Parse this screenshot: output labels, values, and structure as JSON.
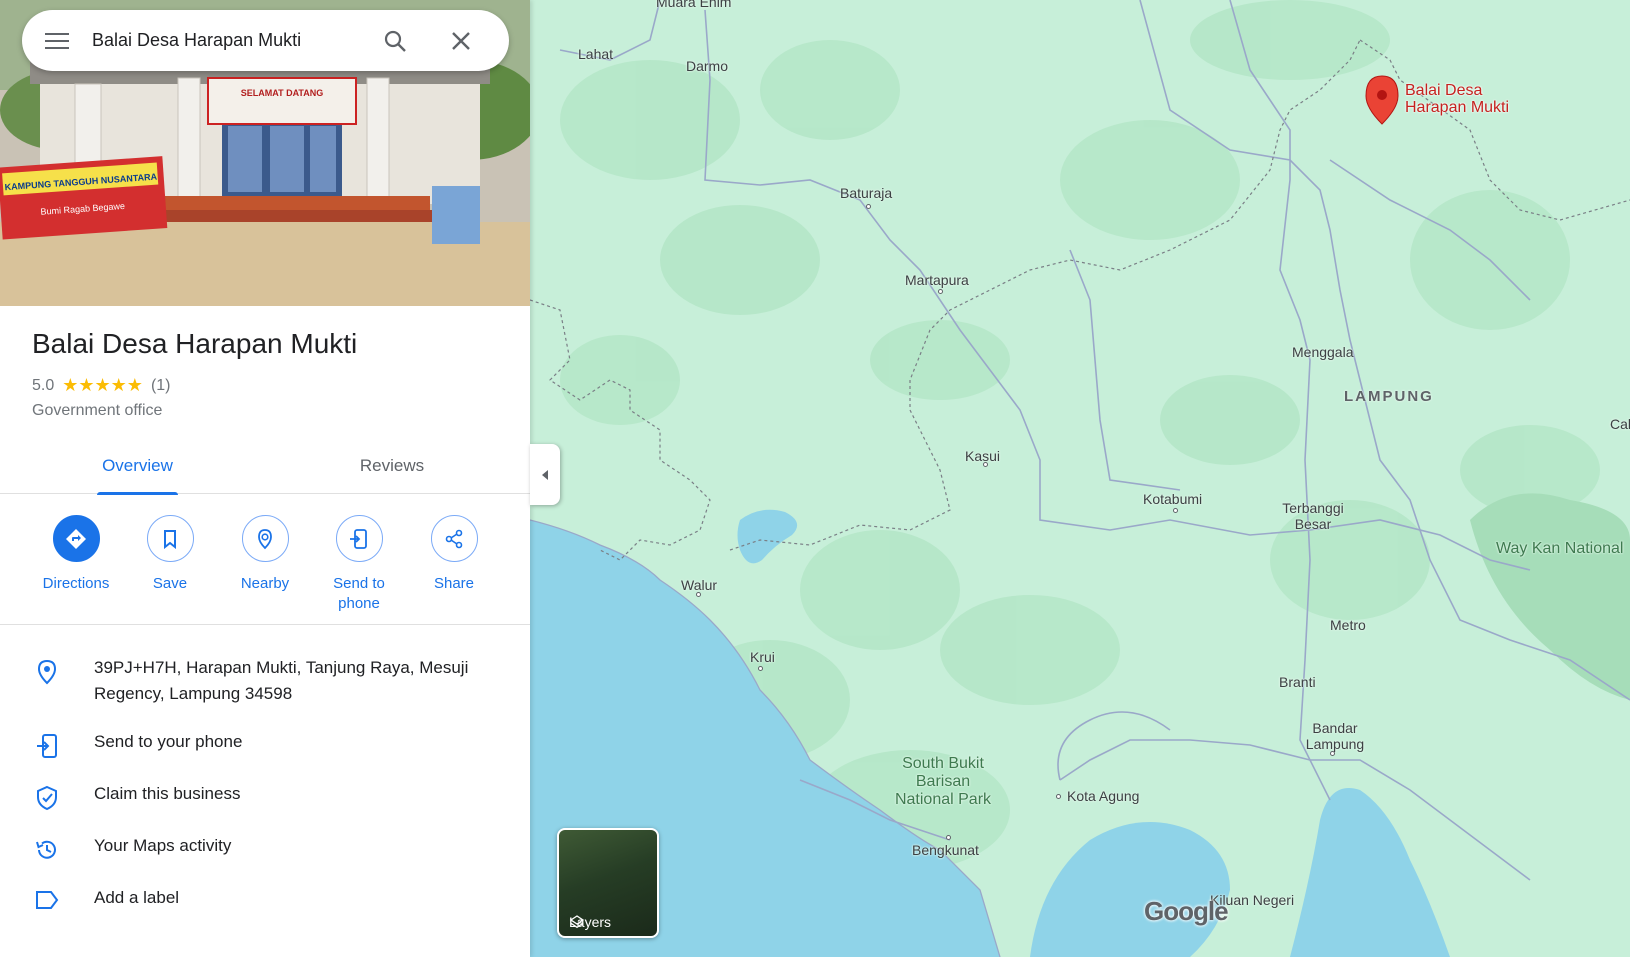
{
  "search": {
    "query": "Balai Desa Harapan Mukti",
    "menu_icon": "hamburger-menu-icon",
    "search_icon": "magnifier-icon",
    "close_icon": "close-x-icon"
  },
  "place": {
    "name": "Balai Desa Harapan Mukti",
    "rating_value": "5.0",
    "stars": "★★★★★",
    "rating_fraction": 1.0,
    "review_count": "(1)",
    "category": "Government office"
  },
  "hero_photo": {
    "banner_top": "SELAMAT DATANG",
    "banner_left": "KAMPUNG TANGGUH NUSANTARA",
    "banner_left_sub": "Bumi Ragab Begawe"
  },
  "tabs": [
    {
      "label": "Overview",
      "active": true
    },
    {
      "label": "Reviews",
      "active": false
    }
  ],
  "actions": [
    {
      "label": "Directions",
      "icon": "directions-icon"
    },
    {
      "label": "Save",
      "icon": "bookmark-icon"
    },
    {
      "label": "Nearby",
      "icon": "nearby-icon"
    },
    {
      "label": "Send to phone",
      "icon": "send-to-phone-icon"
    },
    {
      "label": "Share",
      "icon": "share-icon"
    }
  ],
  "info": [
    {
      "text": "39PJ+H7H, Harapan Mukti, Tanjung Raya, Mesuji Regency, Lampung 34598",
      "icon": "location-pin-icon"
    },
    {
      "text": "Send to your phone",
      "icon": "send-to-phone-icon"
    },
    {
      "text": "Claim this business",
      "icon": "shield-check-icon"
    },
    {
      "text": "Your Maps activity",
      "icon": "history-icon"
    },
    {
      "text": "Add a label",
      "icon": "label-icon"
    }
  ],
  "map": {
    "pin_label": "Balai Desa Harapan Mukti",
    "places": [
      "Muara Enim",
      "Lahat",
      "Darmo",
      "Baturaja",
      "Martapura",
      "Menggala",
      "LAMPUNG",
      "Cab",
      "Kasui",
      "Kotabumi",
      "Terbanggi Besar",
      "Way Kan National",
      "Walur",
      "Metro",
      "Krui",
      "Branti",
      "Bandar Lampung",
      "South Bukit Barisan National Park",
      "Kota Agung",
      "Bengkunat",
      "Kiluan Negeri"
    ],
    "layers_label": "Layers",
    "logo": "Google",
    "colors": {
      "land": "#c7efd9",
      "water": "#8fd3e8",
      "pin": "#ea4335",
      "accent": "#1a73e8"
    }
  }
}
